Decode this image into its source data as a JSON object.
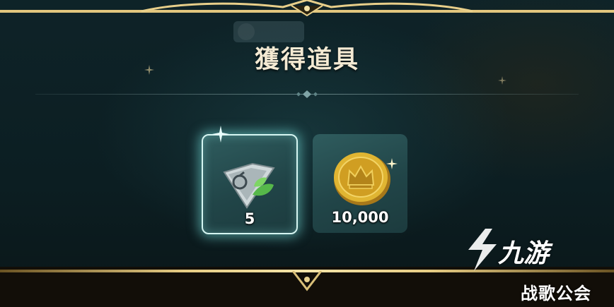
{
  "dialog": {
    "title": "獲得道具"
  },
  "rewards": [
    {
      "name": "leaf-shard-item",
      "icon": "crystal-shard-with-leaf-icon",
      "count": "5",
      "highlighted": true
    },
    {
      "name": "gold-coin-item",
      "icon": "gold-crown-coin-icon",
      "count": "10,000",
      "highlighted": false
    }
  ],
  "watermark": {
    "logo_text": "九游",
    "subtitle": "战歌公会"
  },
  "colors": {
    "gold_frame": "#e6cc84",
    "slot_bg": "#2a5356",
    "highlight_glow": "#9fe8e2",
    "title_text": "#f4ead3"
  }
}
